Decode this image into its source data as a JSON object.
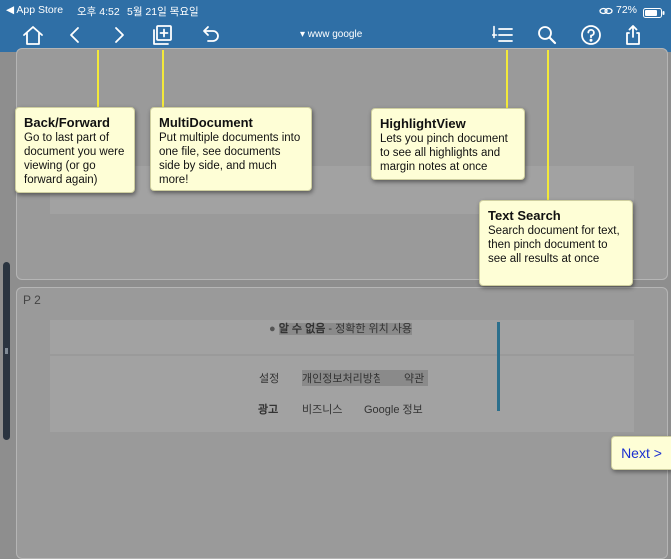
{
  "status_bar": {
    "back_app": "◀ App Store",
    "time": "오후 4:52",
    "date": "5월 21일 목요일",
    "battery": "72%"
  },
  "toolbar": {
    "url": "▾ www google"
  },
  "callouts": {
    "back_forward": {
      "title": "Back/Forward",
      "body": "Go to last part of document you were viewing (or go forward again)"
    },
    "multidocument": {
      "title": "MultiDocument",
      "body": "Put multiple documents into one file, see documents side by side, and much more!"
    },
    "highlightview": {
      "title": "HighlightView",
      "body": "Lets you pinch document to see all highlights and margin notes at once"
    },
    "text_search": {
      "title": "Text Search",
      "body": "Search document for text, then pinch document to see all results at once"
    }
  },
  "page2": {
    "label": "P 2",
    "location_bullet": "●",
    "location_bold": "알 수 없음",
    "location_rest": " - 정확한 위치 사용",
    "links_row1": [
      "설정",
      "개인정보처리방침",
      "약관"
    ],
    "links_row2": [
      "광고",
      "비즈니스",
      "Google 정보"
    ]
  },
  "next_button": "Next >",
  "colors": {
    "toolbar": "#2f6fa6",
    "callout": "#fefed6",
    "pointer_line": "#f3e93a",
    "next_text": "#1a2fd0",
    "scroll_marker": "#2c6f8c"
  }
}
